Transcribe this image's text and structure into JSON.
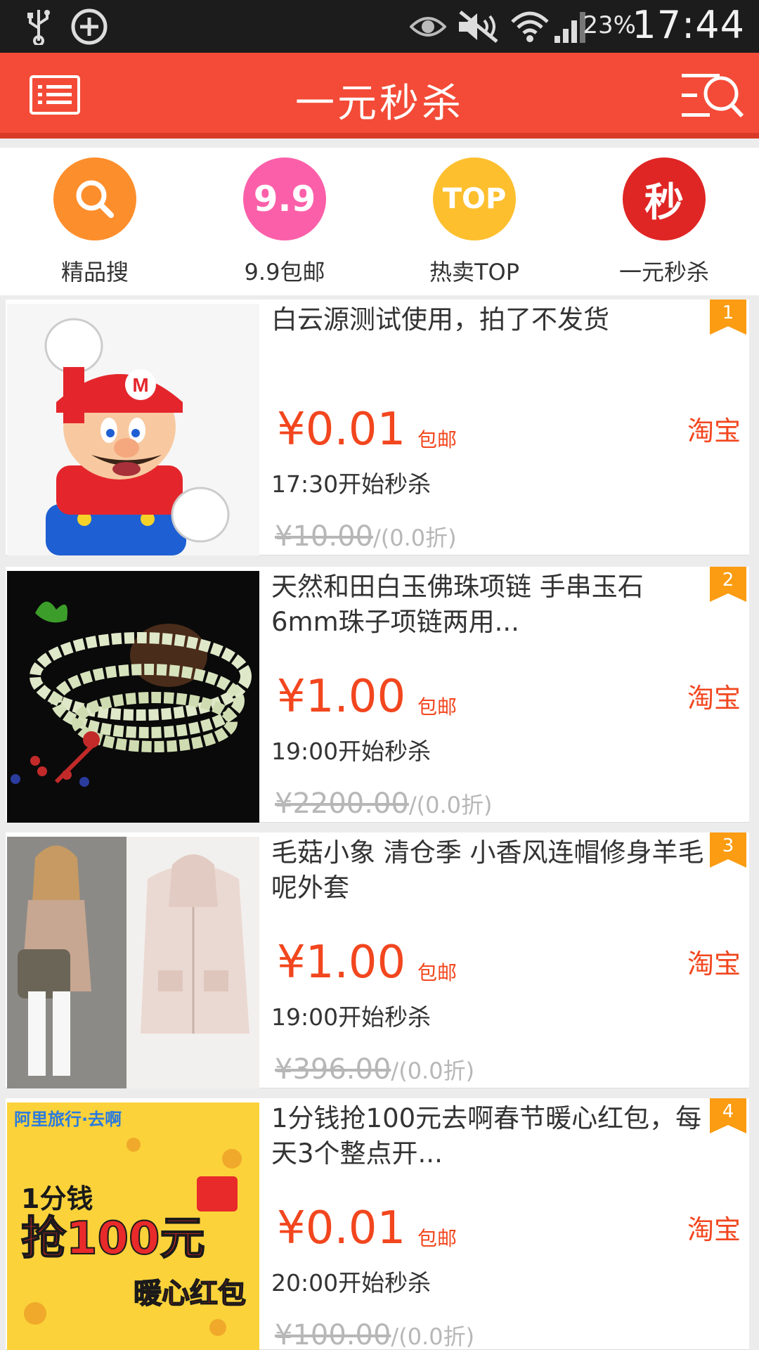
{
  "status_bar": {
    "icons": [
      "usb-icon",
      "add-circle-icon",
      "eye-icon",
      "mute-icon",
      "wifi-icon",
      "signal-icon"
    ],
    "battery": "23%",
    "time": "17:44"
  },
  "header": {
    "title": "一元秒杀",
    "menu_icon": "list-icon",
    "search_icon": "search-filter-icon"
  },
  "categories": [
    {
      "label": "精品搜",
      "icon": "search-icon",
      "icon_text": "",
      "color": "#fd8e2c"
    },
    {
      "label": "9.9包邮",
      "icon": "nine-nine-icon",
      "icon_text": "9.9",
      "color": "#fb5fa9"
    },
    {
      "label": "热卖TOP",
      "icon": "top-icon",
      "icon_text": "TOP",
      "color": "#fdbf2e"
    },
    {
      "label": "一元秒杀",
      "icon": "seckill-icon",
      "icon_text": "秒",
      "color": "#df2624"
    }
  ],
  "colors": {
    "accent": "#f34b37",
    "price": "#f2461e",
    "rank_badge": "#fb9c12"
  },
  "items": [
    {
      "rank": "1",
      "title": "白云源测试使用，拍了不发货",
      "price": "¥0.01",
      "shipping": "包邮",
      "platform": "淘宝",
      "start": "17:30开始秒杀",
      "original": "¥10.00",
      "discount": "/(0.0折)",
      "image": "mario-figure-image"
    },
    {
      "rank": "2",
      "title": "天然和田白玉佛珠项链 手串玉石6mm珠子项链两用...",
      "price": "¥1.00",
      "shipping": "包邮",
      "platform": "淘宝",
      "start": "19:00开始秒杀",
      "original": "¥2200.00",
      "discount": "/(0.0折)",
      "image": "jade-bead-necklace-image"
    },
    {
      "rank": "3",
      "title": "毛菇小象 清仓季 小香风连帽修身羊毛呢外套",
      "price": "¥1.00",
      "shipping": "包邮",
      "platform": "淘宝",
      "start": "19:00开始秒杀",
      "original": "¥396.00",
      "discount": "/(0.0折)",
      "image": "wool-coat-image"
    },
    {
      "rank": "4",
      "title": "1分钱抢100元去啊春节暖心红包，每天3个整点开...",
      "price": "¥0.01",
      "shipping": "包邮",
      "platform": "淘宝",
      "start": "20:00开始秒杀",
      "original": "¥100.00",
      "discount": "/(0.0折)",
      "image": "travel-red-packet-image",
      "image_text": {
        "top": "阿里旅行·去啊",
        "big_1": "1分钱",
        "big_2": "抢100元",
        "sub": "暖心红包"
      }
    }
  ]
}
